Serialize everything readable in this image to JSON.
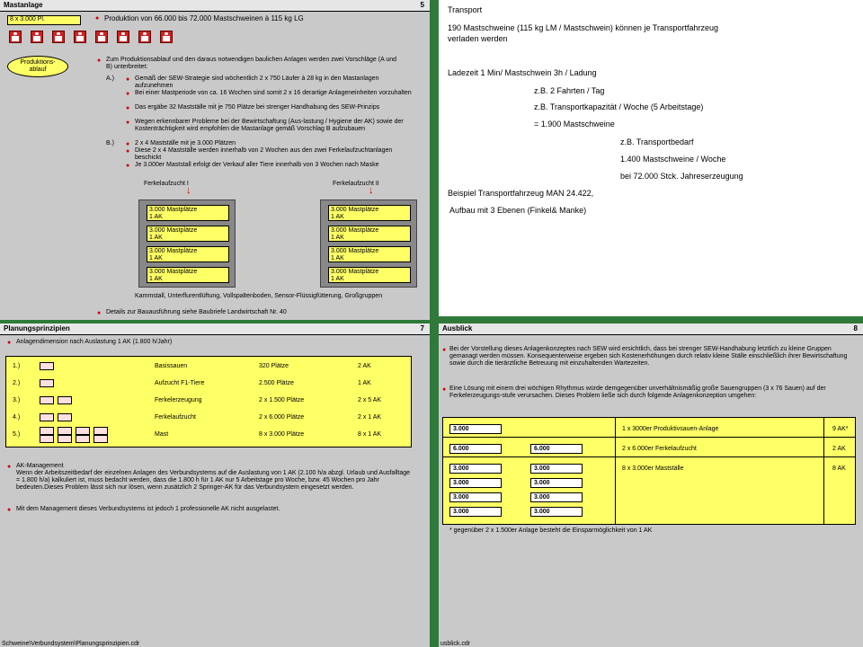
{
  "panel1": {
    "title": "Mastanlage",
    "number": "5",
    "capacity_label": "8 x 3.000 Pl.",
    "production_line": "Produktion von 66.000 bis 72.000 Mastschweinen à 115 kg LG",
    "bubble": "Produktions-\nablauf",
    "intro": "Zum Produktionsablauf und den daraus notwendigen baulichen Anlagen werden zwei Vorschläge (A und B) unterbreitet:",
    "a_label": "A.)",
    "a_items": [
      "Gemäß der SEW-Strategie sind wöchentlich 2 x 750 Läufer à 28 kg in den Mastanlagen aufzunehmen",
      "Bei einer Mastperiode von ca. 16 Wochen sind somit 2 x 16 derartige Anlageneinheiten vorzuhalten",
      "Das ergäbe 32 Mastställe mit je 750 Plätze bei strenger Handhabung des SEW-Prinzips",
      "Wegen erkennbarer Probleme bei der Bewirtschaftung (Aus-lastung / Hygiene der AK) sowie der Kostenträchtigkeit wird empfohlen die Mastanlage gemäß Vorschlag B aufzubauen"
    ],
    "b_label": "B.)",
    "b_items": [
      "2 x 4 Mastställe mit je 3.000 Plätzen",
      "Diese 2 x 4 Mastställe werden innerhalb von 2 Wochen aus den zwei Ferkelaufzuchtanlagen beschickt",
      "Je 3.000er Maststall erfolgt der Verkauf aller Tiere innerhalb von 3 Wochen nach Maske"
    ],
    "stall_left_title": "Ferkelaufzucht I",
    "stall_right_title": "Ferkelaufzucht II",
    "cell_line1": "3.000 Mastplätze",
    "cell_line2": "1 AK",
    "bottom_text": "Kammstall, Unterflurentlüftung, Vollspaltenboden, Sensor-Flüssigfütterung, Großgruppen",
    "bottom_bullet": "Details zur Bauausführung siehe Baubriefe Landwirtschaft Nr. 40"
  },
  "panel2": {
    "lines": [
      "Transport",
      "190 Mastschweine (115 kg LM / Mastschwein) können je Transportfahrzeug",
      "verladen werden",
      "Ladezeit 1 Min/ Mastschwein 3h / Ladung",
      "z.B. 2 Fahrten / Tag",
      "z.B. Transportkapazität / Woche (5 Arbeitstage)",
      "= 1.900 Mastschweine",
      "z.B. Transportbedarf",
      "1.400 Mastschweine / Woche",
      "bei 72.000 Stck. Jahreserzeugung",
      "Beispiel Transportfahrzeug MAN 24.422,",
      " Aufbau mit 3 Ebenen (Finkel& Manke)"
    ]
  },
  "panel3": {
    "title": "Planungsprinzipien",
    "number": "7",
    "heading": "Anlagendimension nach Auslastung 1 AK (1.800 h/Jahr)",
    "rows": [
      {
        "idx": "1.)",
        "name": "Basissauen",
        "places": "320 Plätze",
        "ak": "2 AK"
      },
      {
        "idx": "2.)",
        "name": "Aufzucht F1-Tiere",
        "places": "2.500 Plätze",
        "ak": "1 AK"
      },
      {
        "idx": "3.)",
        "name": "Ferkelerzeugung",
        "places": "2 x 1.500 Plätze",
        "ak": "2 x 5 AK"
      },
      {
        "idx": "4.)",
        "name": "Ferkelaufzucht",
        "places": "2 x 6.000 Plätze",
        "ak": "2 x 1 AK"
      },
      {
        "idx": "5.)",
        "name": "Mast",
        "places": "8 x 3.000 Plätze",
        "ak": "8 x 1 AK"
      }
    ],
    "ak_title": "AK-Management",
    "ak_text": "Wenn der Arbeitszeitbedarf der einzelnen Anlagen des Verbundsystems auf die Auslastung von 1 AK (2.100 h/a abzgl. Urlaub und Ausfalltage = 1.800 h/a) kalkuliert ist, muss bedacht werden, dass die 1.800 h für 1 AK nur 5 Arbeitstage pro Woche, bzw. 45 Wochen pro Jahr bedeuten.Dieses Problem lässt sich nur lösen, wenn zusätzlich 2 Springer-AK für das Verbundsystem eingesetzt werden.",
    "ak_note": "Mit dem Management dieses Verbundsystems ist jedoch 1 professionelle AK nicht ausgelastet.",
    "footer": "Schweine\\Verbundsystem\\Planungsprinzipien.cdr"
  },
  "panel4": {
    "title": "Ausblick",
    "number": "8",
    "para1": "Bei der Vorstellung dieses Anlagenkonzeptes nach SEW wird ersichtlich, dass bei strenger SEW-Handhabung letztlich zu kleine Gruppen gemanagt werden müssen. Konsequenterweise ergeben sich Kostenerhöhungen durch relativ kleine Ställe einschließlich ihrer Bewirtschaftung sowie durch die tierärztliche Betreuung mit einzuhaltenden Wartezeiten.",
    "para2": "Eine Lösung mit einem drei wöchigen Rhythmus würde demgegenüber unverhältnismäßig große Sauengruppen (3 x 76 Sauen) auf der Ferkelerzeugungs-stufe verursachen. Dieses Problem ließe sich durch folgende Anlagenkonzeption umgehen:",
    "row1_box": "3.000",
    "row1_text": "1 x 3000er  Produktivsauen-Anlage",
    "row1_ak": "9 AK*",
    "row2_box": "6.000",
    "row2_text": "2 x 6.000er Ferkelaufzucht",
    "row2_ak": "2 AK",
    "row3_box": "3.000",
    "row3_text": "8 x 3.000er  Mastställe",
    "row3_ak": "8 AK",
    "footnote": "* gegenüber 2 x 1.500er Anlage besteht die Einsparmöglichkeit von 1 AK",
    "footer": "usblick.cdr"
  }
}
